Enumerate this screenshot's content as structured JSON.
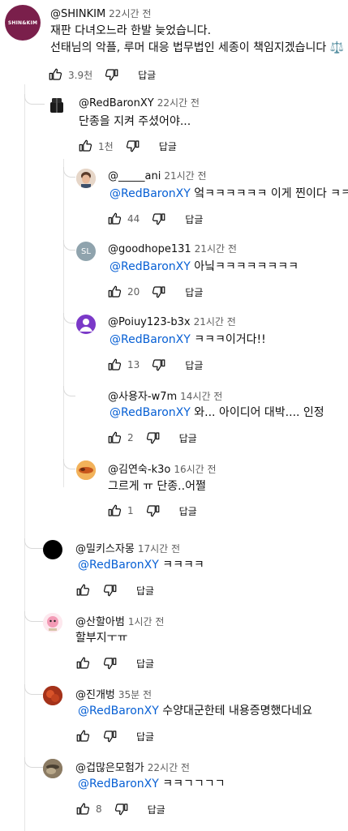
{
  "comments": [
    {
      "author": "@SHINKIM",
      "time": "22시간 전",
      "lines": [
        "재판 다녀오느라 한발 늦었습니다.",
        "선태님의 악플, 루머 대응 법무법인 세종이 책임지겠습니다 ⚖️"
      ],
      "likes": "3.9천",
      "reply_label": "답글",
      "avatar_text": "SHIN&KIM"
    },
    {
      "author": "@RedBaronXY",
      "time": "22시간 전",
      "text": "단종을 지켜 주셨어야...",
      "likes": "1천",
      "reply_label": "답글"
    },
    {
      "author": "@_____ani",
      "time": "21시간 전",
      "mention": "@RedBaronXY",
      "text": " 엌ㅋㅋㅋㅋㅋㅋ 이게 찐이다 ㅋㅋㅋ",
      "likes": "44",
      "reply_label": "답글"
    },
    {
      "author": "@goodhope131",
      "time": "21시간 전",
      "mention": "@RedBaronXY",
      "text": " 아닠ㅋㅋㅋㅋㅋㅋㅋㅋ",
      "likes": "20",
      "reply_label": "답글",
      "avatar_initials": "SL"
    },
    {
      "author": "@Poiuy123-b3x",
      "time": "21시간 전",
      "mention": "@RedBaronXY",
      "text": " ㅋㅋㅋ이거다!!",
      "likes": "13",
      "reply_label": "답글"
    },
    {
      "author": "@사용자-w7m",
      "time": "14시간 전",
      "mention": "@RedBaronXY",
      "text": "  와... 아이디어 대박.... 인정",
      "likes": "2",
      "reply_label": "답글"
    },
    {
      "author": "@김연숙-k3o",
      "time": "16시간 전",
      "text": "그르게 ㅠ 단종..어쩔",
      "likes": "1",
      "reply_label": "답글"
    },
    {
      "author": "@밀키스자몽",
      "time": "17시간 전",
      "mention": "@RedBaronXY",
      "text": " ㅋㅋㅋㅋ",
      "likes": "",
      "reply_label": "답글"
    },
    {
      "author": "@산할아범",
      "time": "1시간 전",
      "text": "할부지ㅜㅠ",
      "likes": "",
      "reply_label": "답글"
    },
    {
      "author": "@진개벙",
      "time": "35분 전",
      "mention": "@RedBaronXY",
      "text": " 수양대군한테 내용증명했다네요",
      "likes": "",
      "reply_label": "답글"
    },
    {
      "author": "@겁많은모험가",
      "time": "22시간 전",
      "mention": "@RedBaronXY",
      "text": " ㅋㅋㄱㄱㄱㄱ",
      "likes": "8",
      "reply_label": "답글"
    }
  ],
  "colors": {
    "mention": "#065fd4",
    "shinkim_bg": "#7a1f4b",
    "goodhope_bg": "#8fa3ad",
    "poiuy_bg": "#7b39c8"
  }
}
